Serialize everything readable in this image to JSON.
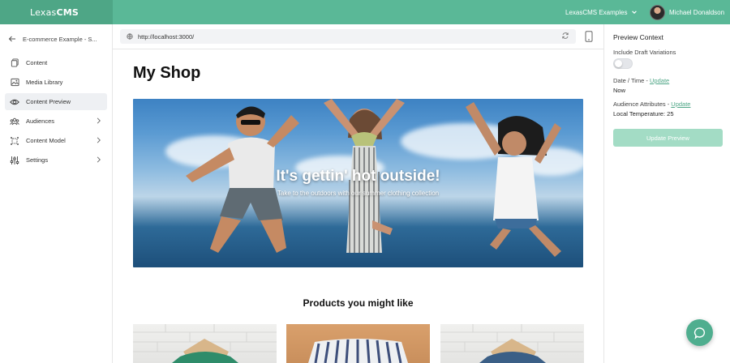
{
  "app": {
    "brand_light": "Lexas",
    "brand_bold": "CMS",
    "org_switcher": "LexasCMS Examples",
    "user_name": "Michael Donaldson",
    "accent": "#5ab897"
  },
  "sidebar": {
    "back_label": "E-commerce Example - S...",
    "items": [
      {
        "label": "Content",
        "icon": "content-icon"
      },
      {
        "label": "Media Library",
        "icon": "image-icon"
      },
      {
        "label": "Content Preview",
        "icon": "eye-icon",
        "active": true
      },
      {
        "label": "Audiences",
        "icon": "users-icon",
        "has_children": true
      },
      {
        "label": "Content Model",
        "icon": "model-icon",
        "has_children": true
      },
      {
        "label": "Settings",
        "icon": "sliders-icon",
        "has_children": true
      }
    ]
  },
  "urlbar": {
    "url": "http://localhost:3000/"
  },
  "preview_page": {
    "title": "My Shop",
    "hero_headline": "It's gettin' hot outside!",
    "hero_subtitle": "Take to the outdoors with our summer clothing collection",
    "products_heading": "Products you might like"
  },
  "context_panel": {
    "title": "Preview Context",
    "draft_label": "Include Draft Variations",
    "draft_enabled": false,
    "datetime_label": "Date / Time - ",
    "datetime_link": "Update",
    "datetime_value": "Now",
    "audience_label": "Audience Attributes - ",
    "audience_link": "Update",
    "audience_value": "Local Temperature: 25",
    "update_button": "Update Preview"
  }
}
